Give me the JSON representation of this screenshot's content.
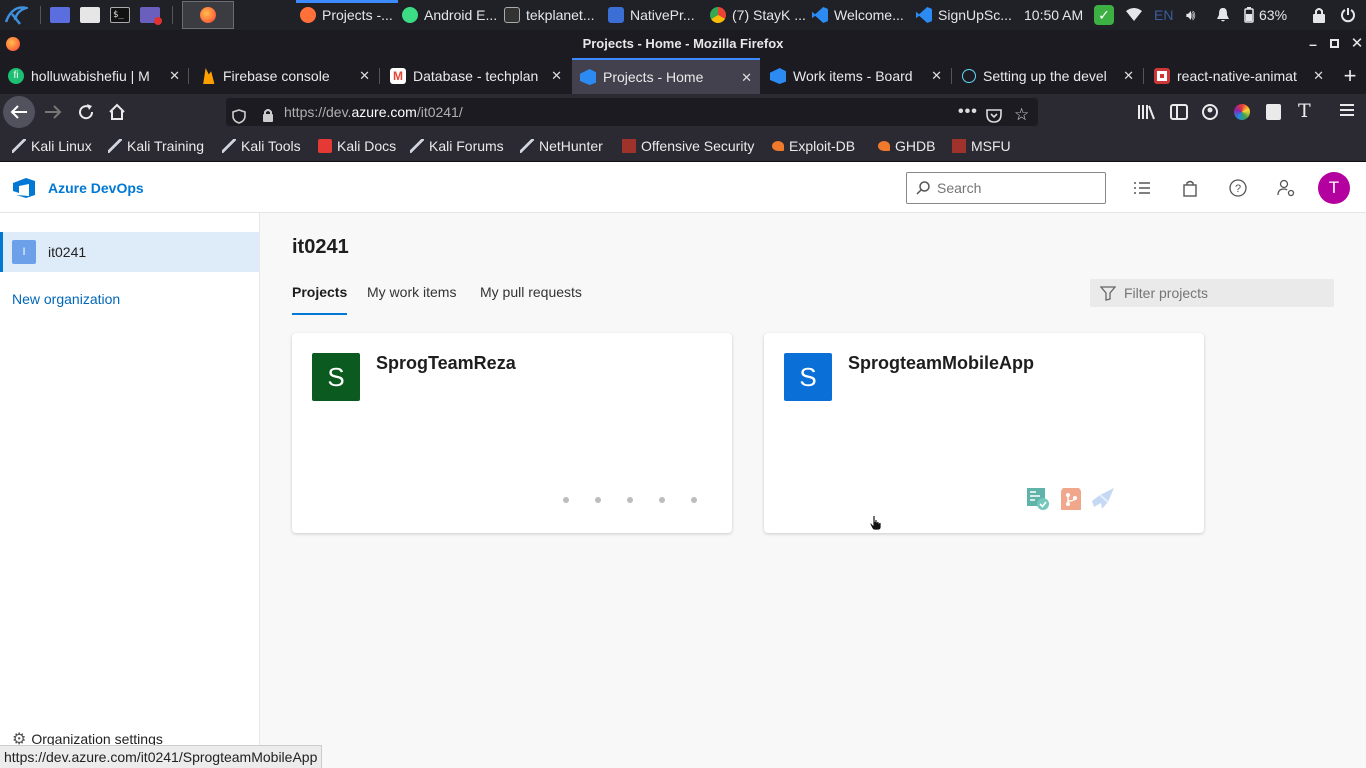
{
  "taskbar": {
    "tasks": [
      {
        "label": "Projects -...",
        "color": "#ff7139"
      },
      {
        "label": "Android E...",
        "color": "#3ddc84"
      },
      {
        "label": "tekplanet...",
        "color": "#444"
      },
      {
        "label": "NativePr...",
        "color": "#3b6fd6"
      },
      {
        "label": "(7) StayK ...",
        "color": "#ea4335"
      },
      {
        "label": "Welcome...",
        "color": "#2b8bf2"
      },
      {
        "label": "SignUpSc...",
        "color": "#2b8bf2"
      }
    ],
    "clock": "10:50 AM",
    "keyboard_layout": "EN",
    "battery": "63%"
  },
  "window": {
    "title": "Projects - Home - Mozilla Firefox"
  },
  "tabs": [
    {
      "label": "holluwabishefiu | M",
      "icon": "fiverr-icon",
      "color": "#1dbf73"
    },
    {
      "label": "Firebase console",
      "icon": "firebase-icon",
      "color": "#ffa000"
    },
    {
      "label": "Database - techplan",
      "icon": "gmail-icon",
      "color": "#ea4335"
    },
    {
      "label": "Projects - Home",
      "icon": "azure-devops-icon",
      "color": "#2b8bf2"
    },
    {
      "label": "Work items - Board",
      "icon": "azure-devops-icon",
      "color": "#2b8bf2"
    },
    {
      "label": "Setting up the devel",
      "icon": "react-icon",
      "color": "#61dafb"
    },
    {
      "label": "react-native-animat",
      "icon": "npm-icon",
      "color": "#cb3837"
    }
  ],
  "url": {
    "prefix": "https://dev.",
    "domain": "azure.com",
    "path": "/it0241/"
  },
  "bookmarks": [
    {
      "label": "Kali Linux",
      "color": "#cfd4dc"
    },
    {
      "label": "Kali Training",
      "color": "#cfd4dc"
    },
    {
      "label": "Kali Tools",
      "color": "#cfd4dc"
    },
    {
      "label": "Kali Docs",
      "color": "#e53935"
    },
    {
      "label": "Kali Forums",
      "color": "#cfd4dc"
    },
    {
      "label": "NetHunter",
      "color": "#cfd4dc"
    },
    {
      "label": "Offensive Security",
      "color": "#a0322c"
    },
    {
      "label": "Exploit-DB",
      "color": "#f07a2b"
    },
    {
      "label": "GHDB",
      "color": "#f07a2b"
    },
    {
      "label": "MSFU",
      "color": "#a0322c"
    }
  ],
  "ado": {
    "brand": "Azure DevOps",
    "search_placeholder": "Search",
    "avatar_letter": "T",
    "avatar_color": "#b4009e",
    "accent": "#0078d4"
  },
  "sidebar": {
    "org_initial": "I",
    "org_name": "it0241",
    "new_org": "New organization",
    "settings": "Organization settings"
  },
  "main": {
    "heading": "it0241",
    "tabs": [
      "Projects",
      "My work items",
      "My pull requests"
    ],
    "filter_placeholder": "Filter projects",
    "projects": [
      {
        "initial": "S",
        "name": "SprogTeamReza",
        "color": "#0b5a1f"
      },
      {
        "initial": "S",
        "name": "SprogteamMobileApp",
        "color": "#0a6fd6"
      }
    ]
  },
  "status_url": "https://dev.azure.com/it0241/SprogteamMobileApp"
}
